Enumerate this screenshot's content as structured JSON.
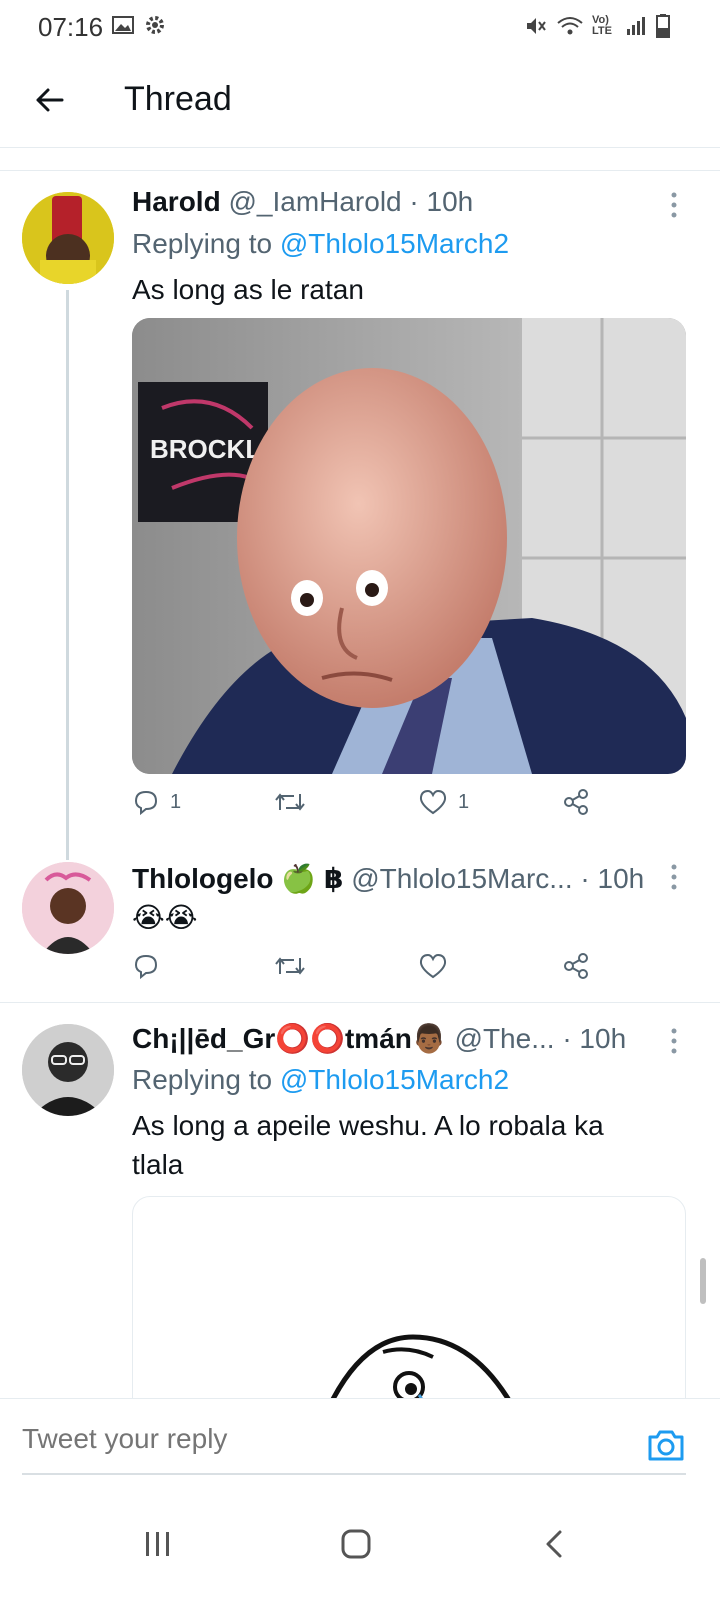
{
  "status_bar": {
    "time": "07:16",
    "lte_label": "Vo) LTE"
  },
  "header": {
    "title": "Thread"
  },
  "tweets": [
    {
      "name": "Harold",
      "handle": "@_IamHarold",
      "dot": "·",
      "time": "10h",
      "replying_prefix": "Replying to",
      "replying_to": "@Thlolo15March2",
      "text": "As long as le ratan",
      "media_caption": "BROCKL",
      "reply_count": "1",
      "retweet_count": "",
      "like_count": "1"
    },
    {
      "name": "Thlologelo",
      "badges": "🍏 ฿",
      "handle": "@Thlolo15Marc...",
      "dot": "·",
      "time": "10h",
      "text": "😭😭",
      "reply_count": "",
      "retweet_count": "",
      "like_count": ""
    },
    {
      "name": "Ch¡||ēd_Gr⭕⭕tmán👨🏾",
      "handle": "@The...",
      "dot": "·",
      "time": "10h",
      "replying_prefix": "Replying to",
      "replying_to": "@Thlolo15March2",
      "text": "As long a apeile weshu. A lo robala ka tlala"
    }
  ],
  "reply_bar": {
    "placeholder": "Tweet your reply"
  },
  "colors": {
    "accent": "#1d9bf0",
    "secondary_text": "#536471",
    "divider": "#e6ecf0"
  },
  "icons": [
    "back-arrow-icon",
    "more-icon",
    "reply-icon",
    "retweet-icon",
    "like-icon",
    "share-icon",
    "camera-icon",
    "recents-icon",
    "home-icon",
    "back-nav-icon"
  ]
}
